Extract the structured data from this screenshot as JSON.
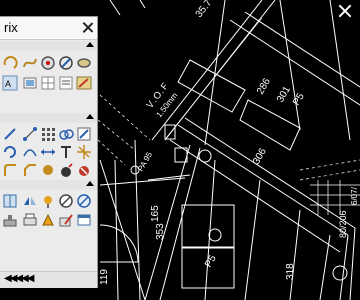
{
  "palette": {
    "title": "rix",
    "scroll_arrows": "◀◀◀◀◀"
  },
  "drawing": {
    "dims": [
      "35.7",
      "Ｖ.Ｏ.Ｆ",
      "1.50mm",
      "286",
      "301",
      "P5",
      "306",
      "PA 95",
      "165",
      "353",
      "P5",
      "119",
      "318",
      "80/206",
      "6/07/"
    ]
  },
  "accent": {
    "cad_line": "#ffffff",
    "panel_bg": "#ebebeb",
    "panel_border": "#9a9a9a"
  }
}
